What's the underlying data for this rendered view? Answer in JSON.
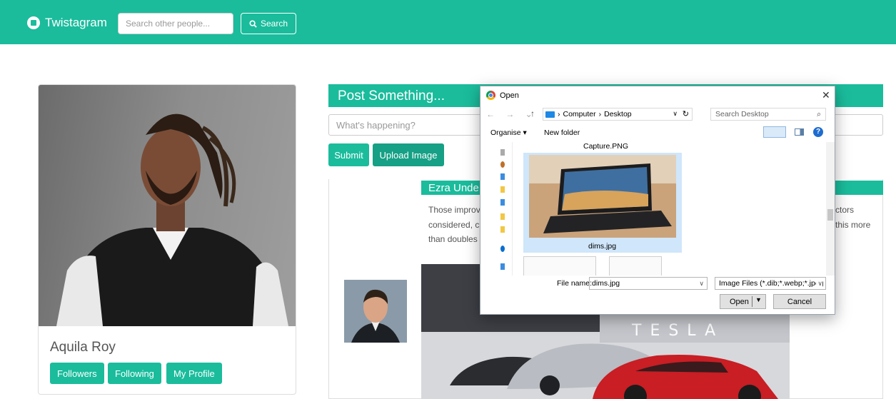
{
  "navbar": {
    "brand": "Twistagram",
    "search_placeholder": "Search other people...",
    "search_button": "Search"
  },
  "profile": {
    "name": "Aquila Roy",
    "buttons": [
      "Followers",
      "Following",
      "My Profile"
    ]
  },
  "composer": {
    "header": "Post Something...",
    "input_placeholder": "What's happening?",
    "submit_label": "Submit",
    "upload_label": "Upload Image"
  },
  "feed": {
    "post_title": "Ezra Unde",
    "text_left": [
      "Those improv",
      "considered, c",
      "than doubles"
    ],
    "text_right": [
      "ctors",
      "this more"
    ],
    "image_brand_text": "TESLA"
  },
  "dialog": {
    "title": "Open",
    "breadcrumb": [
      "Computer",
      "Desktop"
    ],
    "search_placeholder": "Search Desktop",
    "organise": "Organise",
    "new_folder": "New folder",
    "files": [
      {
        "name": "Capture.PNG"
      },
      {
        "name": "dims.jpg",
        "selected": true
      }
    ],
    "file_name_label": "File name:",
    "file_name_value": "dims.jpg",
    "file_type": "Image Files (*.dib;*.webp;*.jpeg",
    "open_label": "Open",
    "cancel_label": "Cancel"
  },
  "colors": {
    "accent": "#1abc9c",
    "accent_dark": "#16a085"
  }
}
